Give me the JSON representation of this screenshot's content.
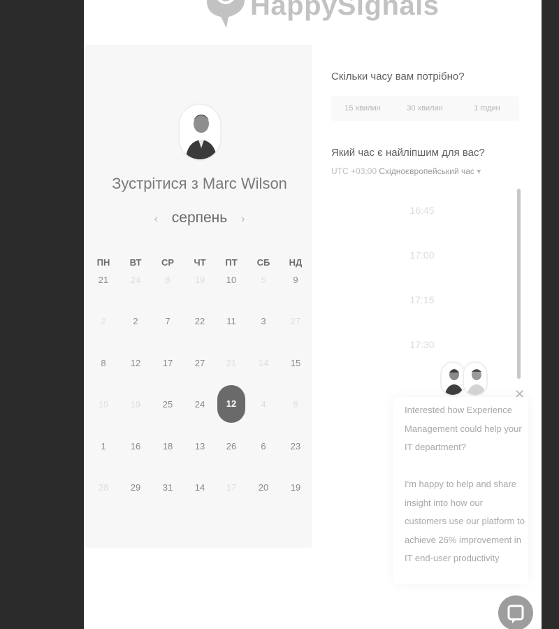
{
  "brand": {
    "name": "HappySignals"
  },
  "meeting": {
    "title": "Зустрітися з Marc Wilson",
    "month": "серпень",
    "prev_icon": "‹",
    "next_icon": "›"
  },
  "calendar": {
    "weekdays": [
      "ПН",
      "ВТ",
      "СР",
      "ЧТ",
      "ПТ",
      "СБ",
      "НД"
    ],
    "rows": [
      [
        "21",
        "24",
        "8",
        "19",
        "10",
        "5",
        "9"
      ],
      [
        "2",
        "2",
        "7",
        "22",
        "11",
        "3",
        "27"
      ],
      [
        "8",
        "12",
        "17",
        "27",
        "21",
        "14",
        "15"
      ],
      [
        "19",
        "19",
        "25",
        "24",
        "12",
        "4",
        "8"
      ],
      [
        "1",
        "16",
        "18",
        "13",
        "26",
        "6",
        "23"
      ],
      [
        "28",
        "29",
        "31",
        "14",
        "17",
        "20",
        "19"
      ]
    ],
    "muted": [
      [
        false,
        true,
        true,
        true,
        false,
        true,
        false
      ],
      [
        true,
        false,
        false,
        false,
        false,
        false,
        true
      ],
      [
        false,
        false,
        false,
        false,
        true,
        true,
        false
      ],
      [
        true,
        true,
        false,
        false,
        false,
        true,
        true
      ],
      [
        false,
        false,
        false,
        false,
        false,
        false,
        false
      ],
      [
        true,
        false,
        false,
        false,
        true,
        false,
        false
      ]
    ],
    "selected": {
      "row": 3,
      "col": 4
    }
  },
  "duration": {
    "question": "Скільки часу вам потрібно?",
    "options": [
      "15 хвилин",
      "30 хвилин",
      "1 годин"
    ]
  },
  "time": {
    "question": "Який час є найліпшим для вас?",
    "timezone_offset": "UTC +03:00",
    "timezone_name": "Східноєвропейський час",
    "dropdown_icon": "▾",
    "slots": [
      "16:45",
      "17:00",
      "17:15",
      "17:30"
    ]
  },
  "chat": {
    "close_icon": "✕",
    "intro": "Interested how Experience Management could help your IT department?",
    "body": "I'm happy to help and share insight into how our customers use our platform to achieve 26% improvement in IT end-user productivity"
  },
  "colors": {
    "selected_day_bg": "#6a6a6a",
    "panel_bg": "#f7f7f7",
    "page_bg": "#2b2b2b"
  }
}
